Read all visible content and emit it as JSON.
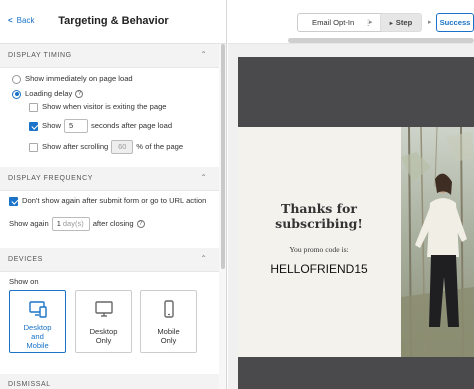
{
  "header": {
    "back_label": "Back",
    "title": "Targeting & Behavior"
  },
  "display_timing": {
    "title": "DISPLAY TIMING",
    "immediately_label": "Show immediately on page load",
    "loading_delay_label": "Loading delay",
    "exiting_label": "Show when visitor is exiting the page",
    "show_prefix": "Show",
    "delay_value": "5",
    "seconds_suffix": "seconds after page load",
    "scroll_prefix": "Show after scrolling",
    "scroll_value": "60",
    "scroll_suffix": "% of the page"
  },
  "display_frequency": {
    "title": "DISPLAY FREQUENCY",
    "dont_show_label": "Don't show again after submit form or go to URL action",
    "show_again_prefix": "Show again",
    "days_value": "1",
    "days_unit": "day(s)",
    "after_closing": "after closing"
  },
  "devices": {
    "title": "DEVICES",
    "show_on_label": "Show on",
    "options": [
      {
        "line1": "Desktop",
        "line2": "and",
        "line3": "Mobile",
        "selected": true
      },
      {
        "line1": "Desktop",
        "line2": "Only"
      },
      {
        "line1": "Mobile",
        "line2": "Only"
      }
    ]
  },
  "dismissal": {
    "title": "DISMISSAL"
  },
  "toolbar": {
    "step_select_label": "Email Opt-In",
    "step_label": "Step",
    "success_label": "Success"
  },
  "preview": {
    "heading_line1": "Thanks for",
    "heading_line2": "subscribing!",
    "promo_label": "You promo code is:",
    "promo_code": "HELLOFRIEND15"
  },
  "colors": {
    "accent": "#1a73c8",
    "preview_bg": "#4a4a4c",
    "popup_bg": "#f3f2ed"
  },
  "icons": [
    "chevron-left-icon",
    "chevron-up-icon",
    "help-icon",
    "desktop-mobile-icon",
    "desktop-icon",
    "mobile-icon",
    "more-icon",
    "chevron-right-icon"
  ]
}
